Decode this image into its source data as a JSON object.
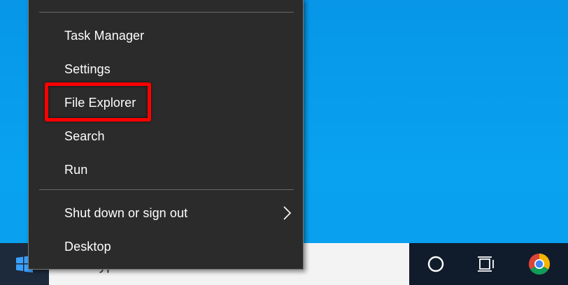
{
  "context_menu": {
    "items": [
      {
        "label": "Task Manager"
      },
      {
        "label": "Settings"
      },
      {
        "label": "File Explorer"
      },
      {
        "label": "Search"
      },
      {
        "label": "Run"
      },
      {
        "label": "Shut down or sign out",
        "has_submenu": true
      },
      {
        "label": "Desktop"
      }
    ],
    "highlighted_item": "File Explorer"
  },
  "taskbar": {
    "search_placeholder": "Type here to search",
    "icons": [
      "windows-logo-icon",
      "cortana-circle-icon",
      "task-view-icon",
      "chrome-icon"
    ]
  },
  "colors": {
    "desktop_background": "#0796e8",
    "menu_background": "#2b2b2b",
    "highlight": "#ff0000",
    "taskbar": "#101c2c"
  }
}
